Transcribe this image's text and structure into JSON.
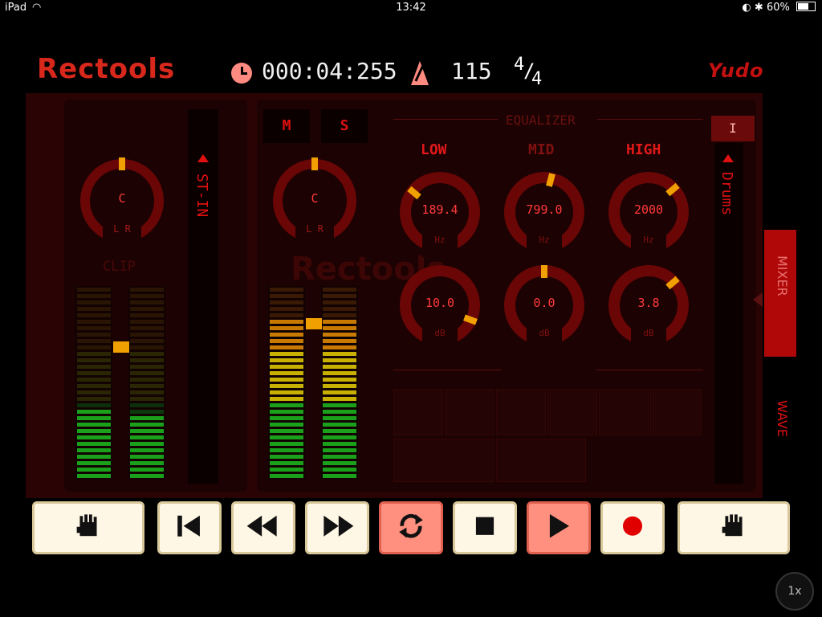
{
  "status_bar": {
    "device": "iPad",
    "time": "13:42",
    "battery": "60%"
  },
  "header": {
    "brand": "Rectools",
    "maker": "Yudo",
    "elapsed_time": "000:04:255",
    "tempo": "115",
    "time_signature_top": "4",
    "time_signature_bottom": "4"
  },
  "input_strip": {
    "pan_value": "C",
    "pan_lr": "L R",
    "clip_label": "CLIP",
    "channel_name": "ST-IN"
  },
  "track_strip": {
    "mute_label": "M",
    "solo_label": "S",
    "pan_value": "C",
    "pan_lr": "L R",
    "track_name": "Drums",
    "channel_number": "I",
    "watermark": "Rectools"
  },
  "equalizer": {
    "title": "EQUALIZER",
    "bands": [
      {
        "name": "LOW",
        "freq": "189.4",
        "freq_unit": "Hz",
        "gain": "10.0",
        "gain_unit": "dB"
      },
      {
        "name": "MID",
        "freq": "799.0",
        "freq_unit": "Hz",
        "gain": "0.0",
        "gain_unit": "dB"
      },
      {
        "name": "HIGH",
        "freq": "2000",
        "freq_unit": "Hz",
        "gain": "3.8",
        "gain_unit": "dB"
      }
    ]
  },
  "side_tabs": {
    "mixer": "MIXER",
    "wave": "WAVE"
  },
  "transport": {
    "icons": [
      "hand-icon",
      "skip-to-start-icon",
      "rewind-icon",
      "fast-forward-icon",
      "loop-icon",
      "stop-icon",
      "play-icon",
      "record-icon",
      "hand-icon"
    ],
    "loop_active": true,
    "play_active": true
  },
  "speed": "1x",
  "colors": {
    "accent": "#e01010",
    "panel": "#2a0404",
    "knob_dot": "#f0a000",
    "meter_green": "#1aa01a",
    "meter_yellow": "#c8b000"
  }
}
